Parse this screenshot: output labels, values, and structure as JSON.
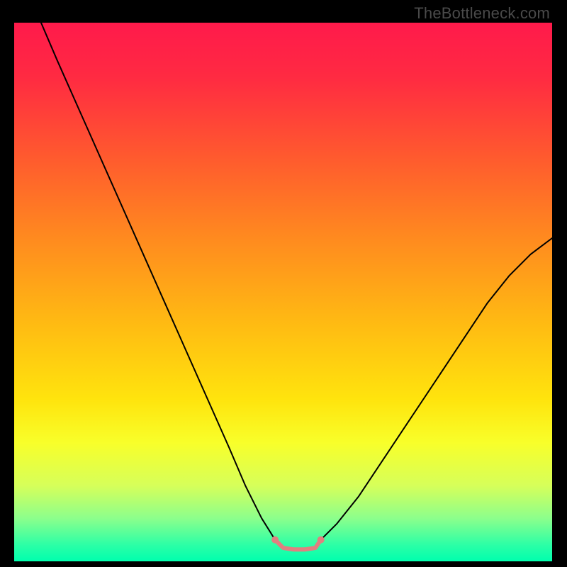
{
  "watermark": "TheBottleneck.com",
  "chart_data": {
    "type": "line",
    "title": "",
    "xlabel": "",
    "ylabel": "",
    "xlim": [
      0,
      100
    ],
    "ylim": [
      0,
      100
    ],
    "background_gradient": {
      "stops": [
        {
          "offset": 0.0,
          "color": "#ff1a4b"
        },
        {
          "offset": 0.1,
          "color": "#ff2a42"
        },
        {
          "offset": 0.25,
          "color": "#ff5a2e"
        },
        {
          "offset": 0.4,
          "color": "#ff8a1f"
        },
        {
          "offset": 0.55,
          "color": "#ffb813"
        },
        {
          "offset": 0.7,
          "color": "#ffe40d"
        },
        {
          "offset": 0.78,
          "color": "#f8ff2a"
        },
        {
          "offset": 0.86,
          "color": "#d6ff5a"
        },
        {
          "offset": 0.92,
          "color": "#8cff8c"
        },
        {
          "offset": 0.97,
          "color": "#2bffa6"
        },
        {
          "offset": 1.0,
          "color": "#00ffae"
        }
      ]
    },
    "series": [
      {
        "name": "left-curve",
        "color": "#000000",
        "width": 2,
        "x": [
          5,
          8,
          12,
          16,
          20,
          24,
          28,
          32,
          36,
          40,
          43,
          46,
          48.5
        ],
        "y": [
          100,
          93,
          84,
          75,
          66,
          57,
          48,
          39,
          30,
          21,
          14,
          8,
          4
        ]
      },
      {
        "name": "right-curve",
        "color": "#000000",
        "width": 2,
        "x": [
          57,
          60,
          64,
          68,
          72,
          76,
          80,
          84,
          88,
          92,
          96,
          100
        ],
        "y": [
          4,
          7,
          12,
          18,
          24,
          30,
          36,
          42,
          48,
          53,
          57,
          60
        ]
      },
      {
        "name": "bottom-flat",
        "color": "#e08080",
        "width": 6,
        "x": [
          48.5,
          50,
          52,
          54,
          56,
          57
        ],
        "y": [
          4,
          2.5,
          2.2,
          2.2,
          2.5,
          4
        ]
      }
    ],
    "markers": [
      {
        "name": "left-dot",
        "x": 48.5,
        "y": 4,
        "r": 5,
        "color": "#e08080"
      },
      {
        "name": "right-dot",
        "x": 57.0,
        "y": 4,
        "r": 5,
        "color": "#e08080"
      }
    ]
  }
}
